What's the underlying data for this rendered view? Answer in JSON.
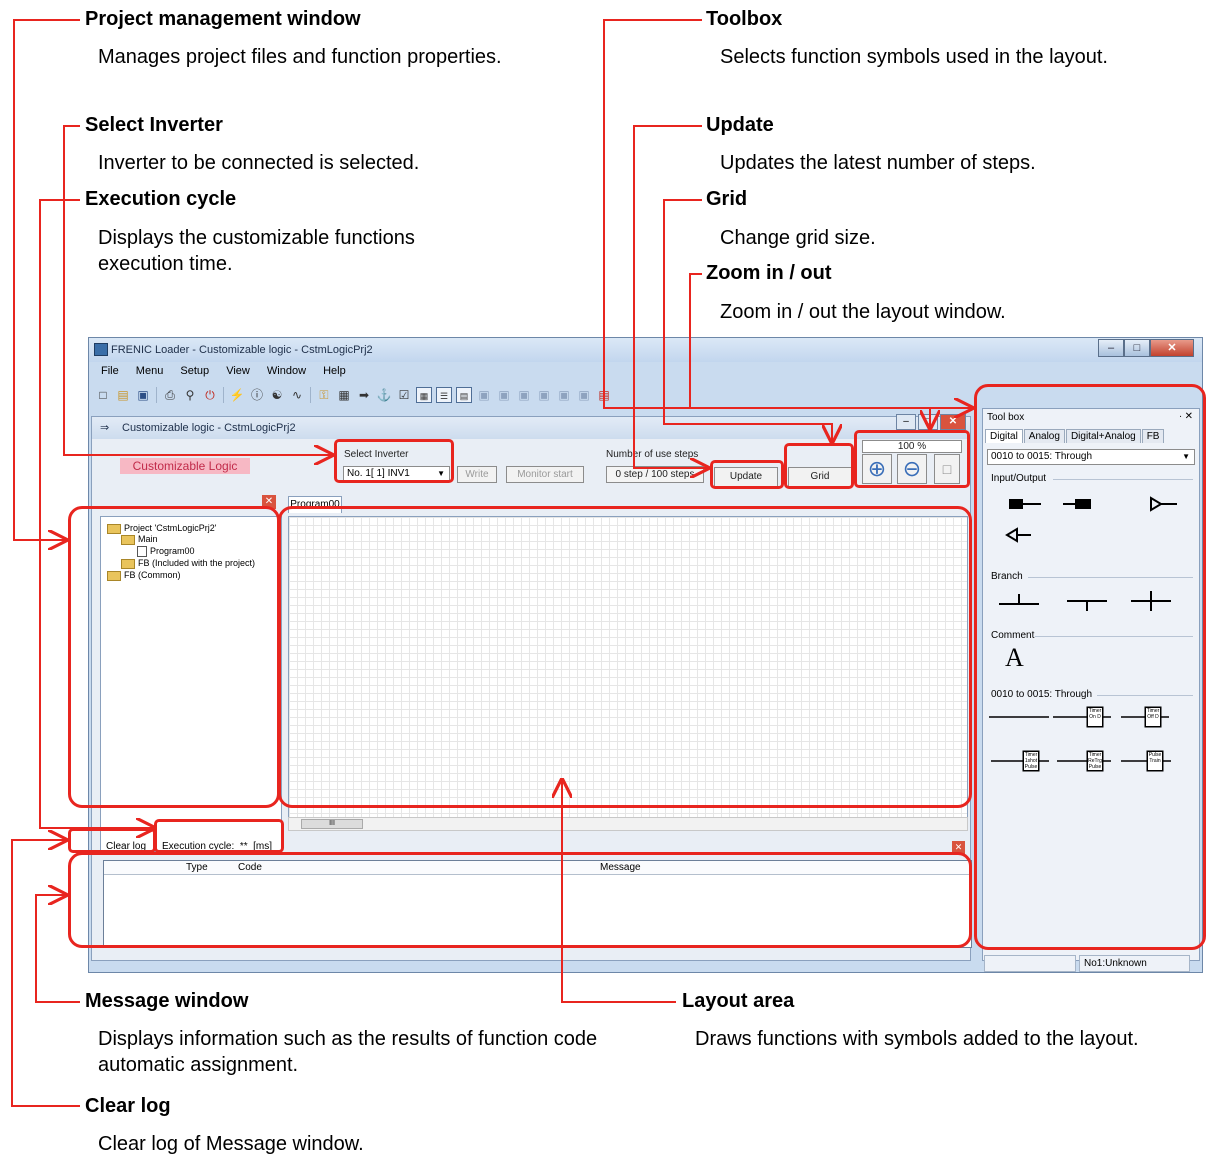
{
  "annotations": {
    "project_window": {
      "title": "Project management window",
      "desc": "Manages project files and function properties."
    },
    "select_inverter": {
      "title": "Select Inverter",
      "desc": "Inverter to be connected is selected."
    },
    "execution_cycle": {
      "title": "Execution cycle",
      "desc": "Displays the customizable functions execution time."
    },
    "toolbox": {
      "title": "Toolbox",
      "desc": "Selects function symbols used in the layout."
    },
    "update": {
      "title": "Update",
      "desc": "Updates the latest number of steps."
    },
    "grid": {
      "title": "Grid",
      "desc": "Change grid size."
    },
    "zoom": {
      "title": "Zoom in / out",
      "desc": "Zoom in / out the layout window."
    },
    "message_window": {
      "title": "Message window",
      "desc": "Displays information such as the results of function code automatic assignment."
    },
    "layout_area": {
      "title": "Layout area",
      "desc": "Draws functions with symbols added to the layout."
    },
    "clear_log": {
      "title": "Clear log",
      "desc": "Clear log of Message window."
    }
  },
  "app": {
    "title": "FRENIC Loader - Customizable logic - CstmLogicPrj2",
    "menu": [
      "File",
      "Menu",
      "Setup",
      "View",
      "Window",
      "Help"
    ],
    "child_title": "Customizable logic - CstmLogicPrj2",
    "customizable_logic_label": "Customizable Logic",
    "select_inverter_label": "Select Inverter",
    "select_inverter_value": "No. 1[ 1] INV1",
    "write_button": "Write",
    "monitor_button": "Monitor start",
    "steps_label": "Number of use steps",
    "steps_value": "0 step / 100 steps",
    "update_button": "Update",
    "grid_button": "Grid",
    "zoom_value": "100 %",
    "program_tab": "Program00",
    "tree": {
      "project": "Project 'CstmLogicPrj2'",
      "main": "Main",
      "program": "Program00",
      "fb_included": "FB (Included with the project)",
      "fb_common": "FB (Common)"
    },
    "clear_log_button": "Clear log",
    "execution_cycle_text": "Execution cycle:  **  [ms]",
    "message_columns": [
      "Type",
      "Code",
      "Message"
    ],
    "toolbox": {
      "title": "Tool box",
      "tabs": [
        "Digital",
        "Analog",
        "Digital+Analog",
        "FB"
      ],
      "dropdown": "0010 to 0015: Through",
      "sections": [
        "Input/Output",
        "Branch",
        "Comment",
        "0010 to 0015: Through"
      ],
      "comment_symbol": "A",
      "fb_blocks": [
        "Timer On D",
        "Timer Off D",
        "Timer 1shot Pulse",
        "Timer ReTrg Pulse",
        "Pulse Train"
      ]
    },
    "status": "No1:Unknown",
    "scroll_glyph": "III"
  }
}
